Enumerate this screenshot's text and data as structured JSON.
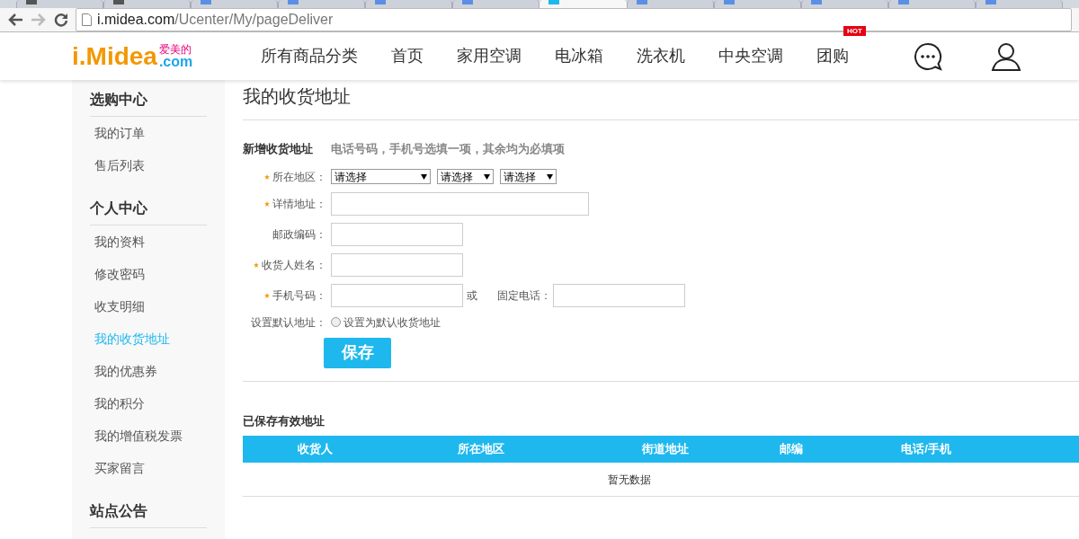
{
  "browser": {
    "tabs": [
      {
        "selected": false
      },
      {
        "selected": false
      },
      {
        "selected": false
      },
      {
        "selected": false
      },
      {
        "selected": false
      },
      {
        "selected": false
      },
      {
        "selected": true
      },
      {
        "selected": false
      },
      {
        "selected": false
      },
      {
        "selected": false
      },
      {
        "selected": false
      },
      {
        "selected": false
      }
    ],
    "url_host": "i.midea.com",
    "url_path": "/Ucenter/My/pageDeliver"
  },
  "header": {
    "logo": {
      "brand": "i.Midea",
      "cn": "爱美的",
      "domain": ".com"
    },
    "nav": [
      {
        "label": "所有商品分类"
      },
      {
        "label": "首页"
      },
      {
        "label": "家用空调"
      },
      {
        "label": "电冰箱"
      },
      {
        "label": "洗衣机"
      },
      {
        "label": "中央空调"
      },
      {
        "label": "团购",
        "badge": "HOT"
      }
    ]
  },
  "sidebar": [
    {
      "title": "选购中心",
      "items": [
        {
          "label": "我的订单",
          "selected": false
        },
        {
          "label": "售后列表",
          "selected": false
        }
      ]
    },
    {
      "title": "个人中心",
      "items": [
        {
          "label": "我的资料",
          "selected": false
        },
        {
          "label": "修改密码",
          "selected": false
        },
        {
          "label": "收支明细",
          "selected": false
        },
        {
          "label": "我的收货地址",
          "selected": true
        },
        {
          "label": "我的优惠券",
          "selected": false
        },
        {
          "label": "我的积分",
          "selected": false
        },
        {
          "label": "我的增值税发票",
          "selected": false
        },
        {
          "label": "买家留言",
          "selected": false
        }
      ]
    },
    {
      "title": "站点公告"
    }
  ],
  "page_title": "我的收货地址",
  "form": {
    "title": "新增收货地址",
    "hint": "电话号码，手机号选填一项，其余均为必填项",
    "rows": [
      {
        "kind": "selects",
        "label": "所在地区：",
        "required": true,
        "selects": [
          "请选择",
          "请选择",
          "请选择"
        ]
      },
      {
        "kind": "text",
        "label": "详情地址：",
        "required": true,
        "wide": true
      },
      {
        "kind": "text",
        "label": "邮政编码：",
        "required": false,
        "wide": false
      },
      {
        "kind": "text",
        "label": "收货人姓名：",
        "required": true,
        "wide": false
      },
      {
        "kind": "phone",
        "label": "手机号码：",
        "required": true,
        "or": "或",
        "label2": "固定电话："
      },
      {
        "kind": "radio",
        "label": "设置默认地址：",
        "required": false,
        "option": "设置为默认收货地址",
        "checked": false
      }
    ],
    "save": "保存"
  },
  "saved": {
    "title": "已保存有效地址",
    "columns": [
      "收货人",
      "所在地区",
      "街道地址",
      "邮编",
      "电话/手机"
    ],
    "empty": "暂无数据"
  }
}
